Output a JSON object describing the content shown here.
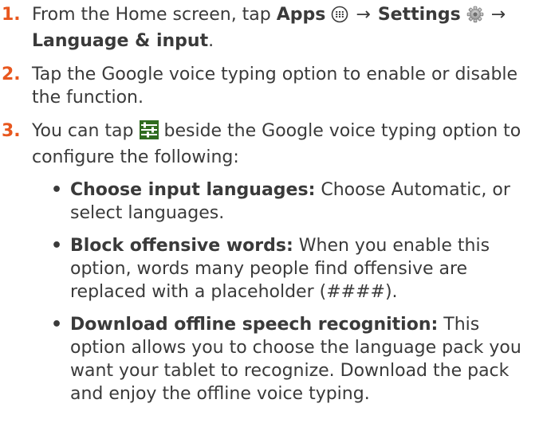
{
  "steps": [
    {
      "number": "1.",
      "part1": "From the Home screen, tap ",
      "apps_label": "Apps",
      "arrow1": "→",
      "settings_label": "Settings",
      "arrow2": "→",
      "lang_label": "Language & input",
      "end": "."
    },
    {
      "number": "2.",
      "text": "Tap the Google voice typing option to enable or disable the function."
    },
    {
      "number": "3.",
      "part1": "You can tap ",
      "part2": " beside the Google voice typing option to configure the following:"
    }
  ],
  "bullets": [
    {
      "dot": "•",
      "term": "Choose input languages:",
      "desc": " Choose Automatic, or select languages."
    },
    {
      "dot": "•",
      "term": "Block offensive words:",
      "desc": " When you enable this option, words many people find offensive are replaced with a placeholder (####)."
    },
    {
      "dot": "•",
      "term": "Download offline speech recognition:",
      "desc": " This option allows you to choose the language pack you want your tablet to recognize. Download the pack and enjoy the offline voice typing."
    }
  ],
  "icons": {
    "apps": "apps-icon",
    "settings": "settings-gear-icon",
    "configure": "configure-sliders-icon"
  },
  "colors": {
    "step_number": "#e8571e",
    "text": "#3a3a3a",
    "configure_icon_bg": "#2f6b1f"
  }
}
